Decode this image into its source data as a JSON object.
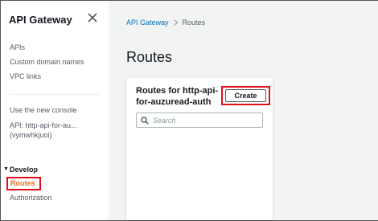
{
  "sidebar": {
    "title": "API Gateway",
    "items": [
      {
        "label": "APIs"
      },
      {
        "label": "Custom domain names"
      },
      {
        "label": "VPC links"
      }
    ],
    "new_console": "Use the new console",
    "api_label_line1": "API: http-api-for-au...",
    "api_label_line2": "(vymwhkjuoi)",
    "section": "Develop",
    "section_items": [
      {
        "label": "Routes",
        "active": true
      },
      {
        "label": "Authorization"
      }
    ]
  },
  "breadcrumb": {
    "parent": "API Gateway",
    "current": "Routes"
  },
  "page": {
    "title": "Routes"
  },
  "card": {
    "title": "Routes for http-api-for-auzuread-auth",
    "create_label": "Create",
    "search_placeholder": "Search"
  },
  "colors": {
    "accent": "#ec7211",
    "link": "#0073bb",
    "highlight": "#e0101a"
  }
}
